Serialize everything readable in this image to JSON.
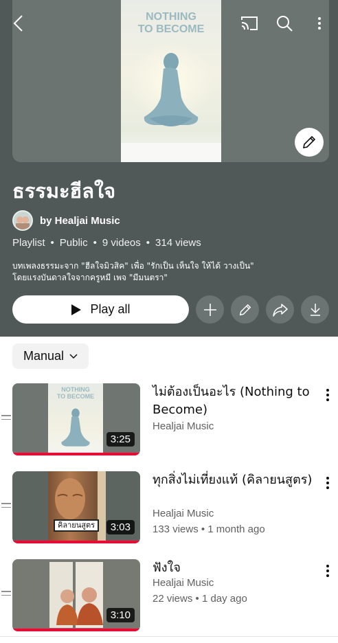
{
  "header": {
    "title": "ธรรมะฮีลใจ",
    "poster_title_line1": "NOTHING",
    "poster_title_line2": "TO BECOME",
    "channel": "by Healjai Music",
    "meta": {
      "type": "Playlist",
      "visibility": "Public",
      "videos": "9 videos",
      "views": "314 views"
    },
    "description_line1": "บทเพลงธรรมะจาก \"ฮีลใจมิวสิค\" เพื่อ \"รักเป็น เห็นใจ ให้ได้ วางเป็น\"",
    "description_line2": "โดยแรงบันดาลใจจากครูหมี เพจ \"มีมนตรา\"",
    "play_all_label": "Play all",
    "icons": [
      "back-icon",
      "cast-icon",
      "search-icon",
      "more-icon",
      "edit-icon",
      "add-icon",
      "share-icon",
      "download-icon",
      "play-icon"
    ]
  },
  "sort": {
    "label": "Manual"
  },
  "videos": [
    {
      "title": "ไม่ต้องเป็นอะไร (Nothing to Become)",
      "channel": "Healjai Music",
      "stats": "",
      "duration": "3:25",
      "thumb_line1": "NOTHING",
      "thumb_line2": "TO BECOME"
    },
    {
      "title": "ทุกสิ่งไม่เที่ยงแท้ (คิลายนสูตร)",
      "channel": "Healjai Music",
      "stats": "133 views • 1 month ago",
      "duration": "3:03",
      "thumb_caption": "คิลายนสูตร"
    },
    {
      "title": "ฟังใจ",
      "channel": "Healjai Music",
      "stats": "22 views • 1 day ago",
      "duration": "3:10"
    }
  ],
  "colors": {
    "header_bg": "#505858",
    "progress": "#ff0033",
    "button_dark": "#6c7373"
  }
}
